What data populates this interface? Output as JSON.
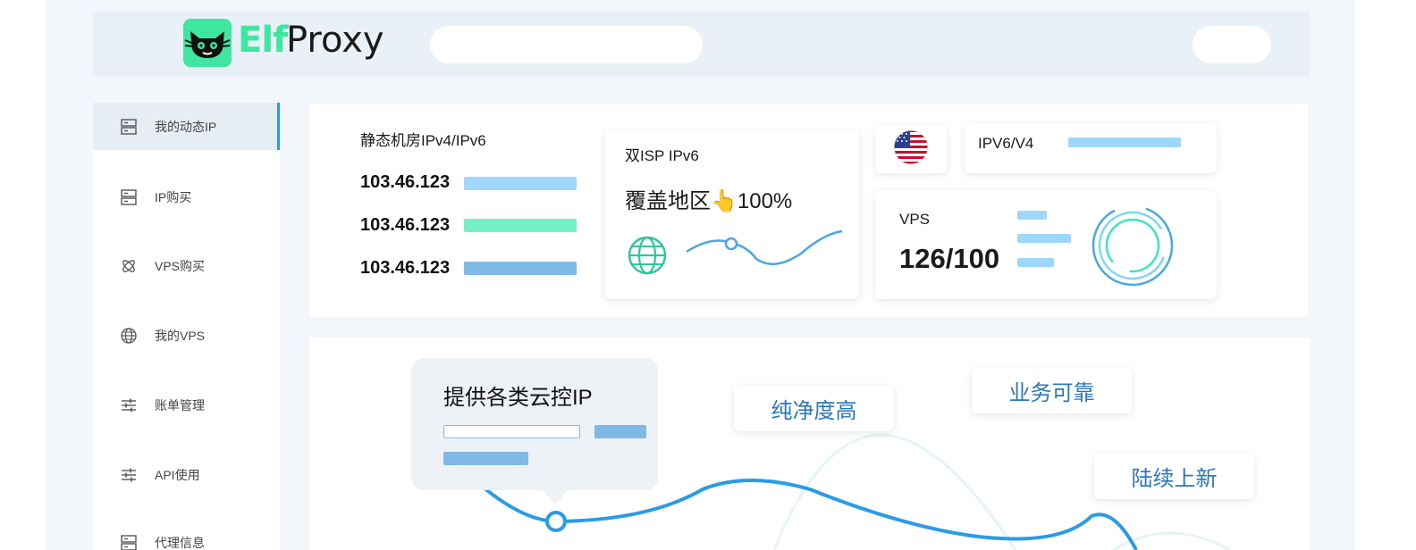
{
  "header": {
    "logo_elf": "Elf",
    "logo_proxy": "Proxy"
  },
  "sidebar": {
    "items": [
      {
        "label": "我的动态IP",
        "icon": "server-icon",
        "active": true
      },
      {
        "label": "IP购买",
        "icon": "server-icon",
        "active": false
      },
      {
        "label": "VPS购买",
        "icon": "atom-icon",
        "active": false
      },
      {
        "label": "我的VPS",
        "icon": "globe-icon",
        "active": false
      },
      {
        "label": "账单管理",
        "icon": "sliders-icon",
        "active": false
      },
      {
        "label": "API使用",
        "icon": "sliders-icon",
        "active": false
      },
      {
        "label": "代理信息",
        "icon": "server-icon",
        "active": false
      }
    ]
  },
  "stats": {
    "static_title": "静态机房IPv4/IPv6",
    "ips": [
      "103.46.123",
      "103.46.123",
      "103.46.123"
    ],
    "isp_title": "双ISP IPv6",
    "coverage": "覆盖地区👆100%",
    "ipv_label": "IPV6/V4",
    "vps_label": "VPS",
    "vps_count": "126/100"
  },
  "features": {
    "bubble_title": "提供各类云控IP",
    "tags": [
      "纯净度高",
      "业务可靠",
      "陆续上新"
    ]
  },
  "colors": {
    "brand_green": "#3ee6a0",
    "accent_blue": "#2a9be6",
    "bar_light_blue": "#9fd6fb",
    "bar_mint": "#74f0c9",
    "bar_blue": "#7fb9e6"
  }
}
